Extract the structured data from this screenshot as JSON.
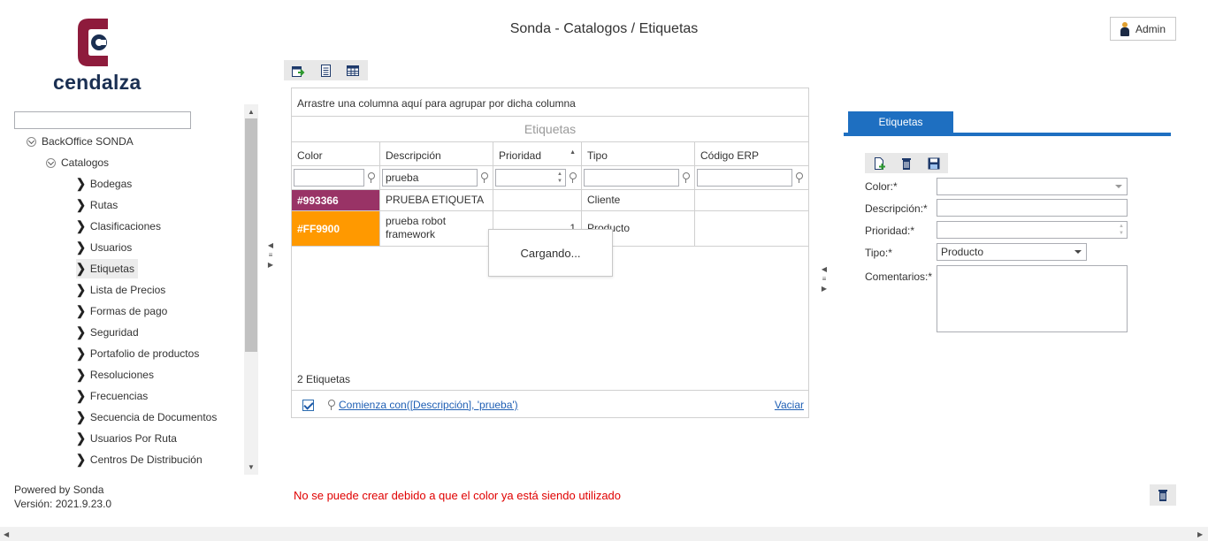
{
  "header": {
    "title": "Sonda - Catalogos / Etiquetas",
    "user_label": "Admin"
  },
  "logo": {
    "text": "cendalza"
  },
  "sidebar": {
    "search_value": "",
    "root": "BackOffice SONDA",
    "group": "Catalogos",
    "items": [
      {
        "label": "Bodegas"
      },
      {
        "label": "Rutas"
      },
      {
        "label": "Clasificaciones"
      },
      {
        "label": "Usuarios"
      },
      {
        "label": "Etiquetas",
        "selected": true
      },
      {
        "label": "Lista de Precios"
      },
      {
        "label": "Formas de pago"
      },
      {
        "label": "Seguridad"
      },
      {
        "label": "Portafolio de productos"
      },
      {
        "label": "Resoluciones"
      },
      {
        "label": "Frecuencias"
      },
      {
        "label": "Secuencia de Documentos"
      },
      {
        "label": "Usuarios Por Ruta"
      },
      {
        "label": "Centros De Distribución"
      }
    ]
  },
  "footer": {
    "powered": "Powered by Sonda",
    "version": "Versión: 2021.9.23.0"
  },
  "grid": {
    "group_panel_text": "Arrastre una columna aquí para agrupar por dicha columna",
    "caption": "Etiquetas",
    "columns": [
      "Color",
      "Descripción",
      "Prioridad",
      "Tipo",
      "Código ERP"
    ],
    "filters": {
      "color": "",
      "descripcion": "prueba",
      "prioridad": "",
      "tipo": "",
      "codigo_erp": ""
    },
    "rows": [
      {
        "color": "#993366",
        "descripcion": "PRUEBA ETIQUETA",
        "prioridad": "",
        "tipo": "Cliente",
        "codigo_erp": ""
      },
      {
        "color": "#FF9900",
        "descripcion": "prueba robot framework",
        "prioridad": "1",
        "tipo": "Producto",
        "codigo_erp": ""
      }
    ],
    "footer_count": "2 Etiquetas",
    "filter_expression": "Comienza con([Descripción], 'prueba')",
    "clear_filter": "Vaciar",
    "loading_text": "Cargando..."
  },
  "form": {
    "tab_label": "Etiquetas",
    "labels": {
      "color": "Color:*",
      "descripcion": "Descripción:*",
      "prioridad": "Prioridad:*",
      "tipo": "Tipo:*",
      "comentarios": "Comentarios:*"
    },
    "values": {
      "color": "",
      "descripcion": "",
      "prioridad": "",
      "tipo": "Producto",
      "comentarios": ""
    }
  },
  "error_message": "No se puede crear debido a que el color ya está siendo utilizado",
  "colors": {
    "accent": "#1e6fc1",
    "error": "#e00000",
    "logo_red": "#8e1b3c",
    "logo_navy": "#1a2f52"
  }
}
